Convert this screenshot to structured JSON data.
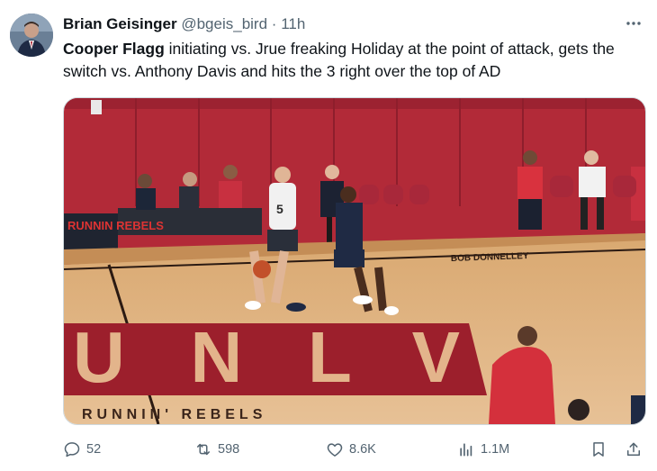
{
  "tweet": {
    "author": {
      "display_name": "Brian Geisinger",
      "handle": "@bgeis_bird",
      "separator": "·",
      "time": "11h"
    },
    "text": {
      "bold_lead": "Cooper Flagg",
      "rest": " initiating vs. Jrue freaking Holiday at the point of attack, gets the switch vs. Anthony Davis and hits the 3 right over the top of AD"
    },
    "media": {
      "court_logo_text": "UNLV",
      "baseline_text": "RUNNIN' REBELS",
      "banner_text": "RUNNIN REBELS",
      "sideline_text": "BOB DONNELLEY",
      "player_number": "5"
    },
    "actions": {
      "replies": "52",
      "reposts": "598",
      "likes": "8.6K",
      "views": "1.1M"
    }
  }
}
